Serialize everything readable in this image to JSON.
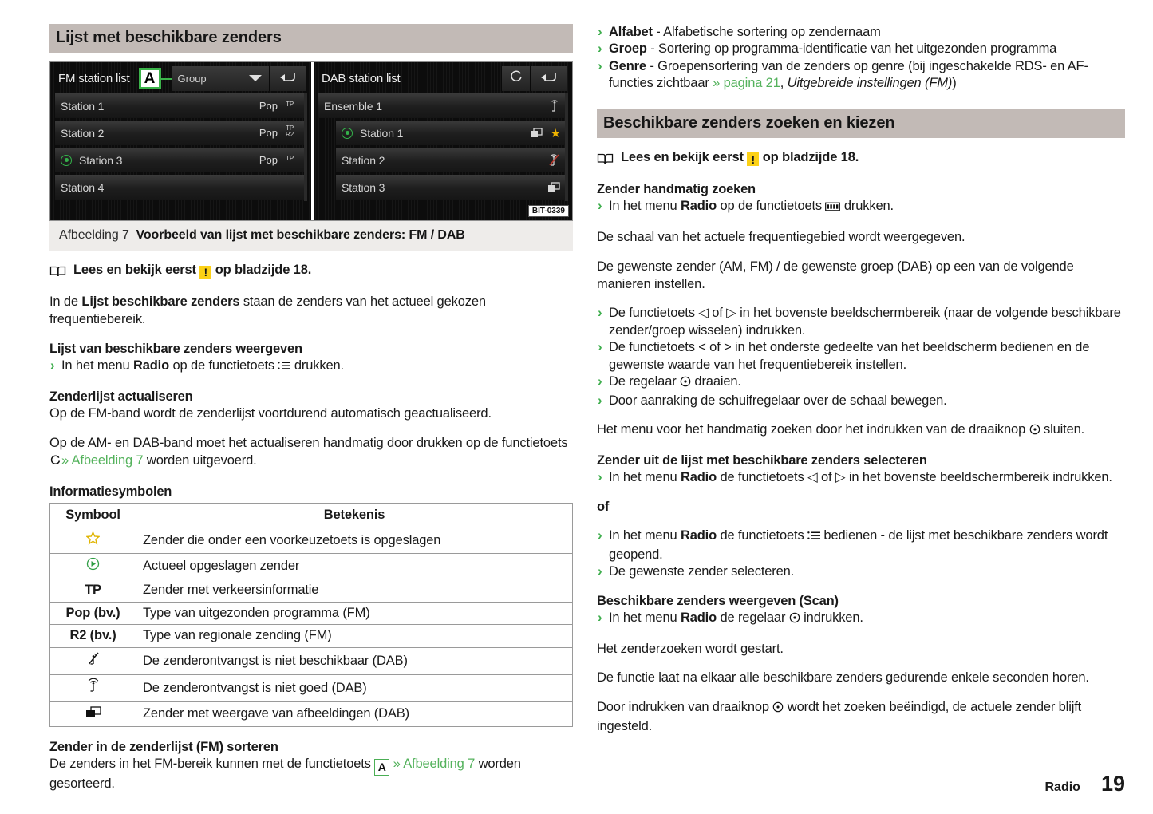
{
  "colors": {
    "accent_green": "#54b25c",
    "heading_bar": "#c2bab6",
    "warn_yellow": "#fcd116",
    "star_gold": "#f0b400"
  },
  "left": {
    "section_heading": "Lijst met beschikbare zenders",
    "figure": {
      "fm": {
        "title": "FM station list",
        "callout": "A",
        "dropdown_value": "Group",
        "rows": [
          {
            "name": "Station 1",
            "type": "Pop",
            "flags": [
              "TP"
            ],
            "current": false
          },
          {
            "name": "Station 2",
            "type": "Pop",
            "flags": [
              "TP",
              "R2"
            ],
            "current": false
          },
          {
            "name": "Station 3",
            "type": "Pop",
            "flags": [
              "TP"
            ],
            "current": true
          },
          {
            "name": "Station 4",
            "type": "",
            "flags": [],
            "current": false
          }
        ]
      },
      "dab": {
        "title": "DAB station list",
        "rows": [
          {
            "name": "Ensemble 1",
            "indent": false,
            "current": false,
            "icon": "weak-signal",
            "star": false
          },
          {
            "name": "Station 1",
            "indent": true,
            "current": true,
            "icon": "slideshow",
            "star": true
          },
          {
            "name": "Station 2",
            "indent": true,
            "current": false,
            "icon": "no-signal",
            "star": false
          },
          {
            "name": "Station 3",
            "indent": true,
            "current": false,
            "icon": "slideshow",
            "star": false
          }
        ]
      },
      "code": "BIT-0339",
      "caption_label": "Afbeelding 7",
      "caption_text": "Voorbeeld van lijst met beschikbare zenders: FM / DAB"
    },
    "note": {
      "pre": "Lees en bekijk eerst",
      "mark": "!",
      "post": "op bladzijde 18."
    },
    "intro": {
      "a": "In de ",
      "b": "Lijst beschikbare zenders",
      "c": " staan de zenders van het actueel gekozen frequentiebereik."
    },
    "h_weergeven": "Lijst van beschikbare zenders weergeven",
    "b_weergeven": {
      "a": "In het menu ",
      "b": "Radio",
      "c": " op de functietoets ",
      "icon": "list-icon",
      "d": " drukken."
    },
    "h_actualiseren": "Zenderlijst actualiseren",
    "p_fm": "Op de FM-band wordt de zenderlijst voortdurend automatisch geactualiseerd.",
    "p_am": {
      "a": "Op de AM- en DAB-band moet het actualiseren handmatig door drukken op de functietoets ",
      "icon": "refresh-icon",
      "link": "» Afbeelding 7",
      "b": " worden uitgevoerd."
    },
    "h_symbolen": "Informatiesymbolen",
    "table": {
      "headers": [
        "Symbool",
        "Betekenis"
      ],
      "rows": [
        {
          "symbol": "star-outline-icon",
          "symbol_text": "",
          "meaning": "Zender die onder een voorkeuzetoets is opgeslagen"
        },
        {
          "symbol": "play-circle-icon",
          "symbol_text": "",
          "meaning": "Actueel opgeslagen zender"
        },
        {
          "symbol": "text",
          "symbol_text": "TP",
          "meaning": "Zender met verkeersinformatie"
        },
        {
          "symbol": "text",
          "symbol_text": "Pop (bv.)",
          "meaning": "Type van uitgezonden programma (FM)"
        },
        {
          "symbol": "text",
          "symbol_text": "R2 (bv.)",
          "meaning": "Type van regionale zending (FM)"
        },
        {
          "symbol": "no-signal-icon",
          "symbol_text": "",
          "meaning": "De zenderontvangst is niet beschikbaar (DAB)"
        },
        {
          "symbol": "weak-signal-icon",
          "symbol_text": "",
          "meaning": "De zenderontvangst is niet goed (DAB)"
        },
        {
          "symbol": "slideshow-icon",
          "symbol_text": "",
          "meaning": "Zender met weergave van afbeeldingen (DAB)"
        }
      ]
    },
    "h_sorteren": "Zender in de zenderlijst (FM) sorteren",
    "p_sorteren": {
      "a": "De zenders in het FM-bereik kunnen met de functietoets ",
      "box": "A",
      "link": "» Afbeelding 7",
      "b": " worden gesorteerd."
    }
  },
  "right": {
    "sort_options": [
      {
        "term": "Alfabet",
        "desc": " - Alfabetische sortering op zendernaam"
      },
      {
        "term": "Groep",
        "desc": " - Sortering op programma-identificatie van het uitgezonden programma"
      },
      {
        "term": "Genre",
        "desc_a": " - Groepensortering van de zenders op genre (bij ingeschakelde RDS- en AF-functies zichtbaar ",
        "link": "» pagina 21",
        "desc_b": ", ",
        "italic": "Uitgebreide instellingen (FM)",
        "desc_c": ")"
      }
    ],
    "section_heading": "Beschikbare zenders zoeken en kiezen",
    "note": {
      "pre": "Lees en bekijk eerst",
      "mark": "!",
      "post": "op bladzijde 18."
    },
    "h_handmatig": "Zender handmatig zoeken",
    "b_handmatig": {
      "a": "In het menu ",
      "b": "Radio",
      "c": " op de functietoets ",
      "icon": "keypad-icon",
      "d": " drukken."
    },
    "p_schaal": "De schaal van het actuele frequentiegebied wordt weergegeven.",
    "p_gewenste": "De gewenste zender (AM, FM) / de gewenste groep (DAB) op een van de volgende manieren instellen.",
    "bullets_instellen": [
      {
        "a": "De functietoets ",
        "icon1": "◁",
        "mid": " of ",
        "icon2": "▷",
        "b": " in het bovenste beeldschermbereik (naar de volgende beschikbare zender/groep wisselen) indrukken."
      },
      {
        "a": "De functietoets ",
        "icon1": "<",
        "mid": " of ",
        "icon2": ">",
        "b": " in het onderste gedeelte van het beeldscherm bedienen en de gewenste waarde van het frequentiebereik instellen."
      },
      {
        "a": "De regelaar ",
        "icon1": "knob-icon",
        "mid": "",
        "icon2": "",
        "b": " draaien."
      },
      {
        "a": "Door aanraking de schuifregelaar over de schaal bewegen.",
        "icon1": "",
        "mid": "",
        "icon2": "",
        "b": ""
      }
    ],
    "p_sluiten": {
      "a": "Het menu voor het handmatig zoeken door het indrukken van de draaiknop ",
      "icon": "knob-icon",
      "b": " sluiten."
    },
    "h_selecteren": "Zender uit de lijst met beschikbare zenders selecteren",
    "b_selecteren": {
      "a": "In het menu ",
      "b": "Radio",
      "c": " de functietoets ",
      "icon1": "◁",
      "mid": " of ",
      "icon2": "▷",
      "d": " in het bovenste beeldschermbereik indrukken."
    },
    "of": "of",
    "b_lijst": {
      "a": "In het menu ",
      "b": "Radio",
      "c": " de functietoets ",
      "icon": "list-icon",
      "d": " bedienen - de lijst met beschikbare zenders wordt geopend."
    },
    "b_kiezen": "De gewenste zender selecteren.",
    "h_scan": "Beschikbare zenders weergeven (Scan)",
    "b_scan": {
      "a": "In het menu ",
      "b": "Radio",
      "c": " de regelaar ",
      "icon": "knob-icon",
      "d": " indrukken."
    },
    "p_start": "Het zenderzoeken wordt gestart.",
    "p_functie": "De functie laat na elkaar alle beschikbare zenders gedurende enkele seconden horen.",
    "p_einde": {
      "a": "Door indrukken van draaiknop ",
      "icon": "knob-icon",
      "b": " wordt het zoeken beëindigd, de actuele zender blijft ingesteld."
    }
  },
  "footer": {
    "chapter": "Radio",
    "page": "19"
  }
}
